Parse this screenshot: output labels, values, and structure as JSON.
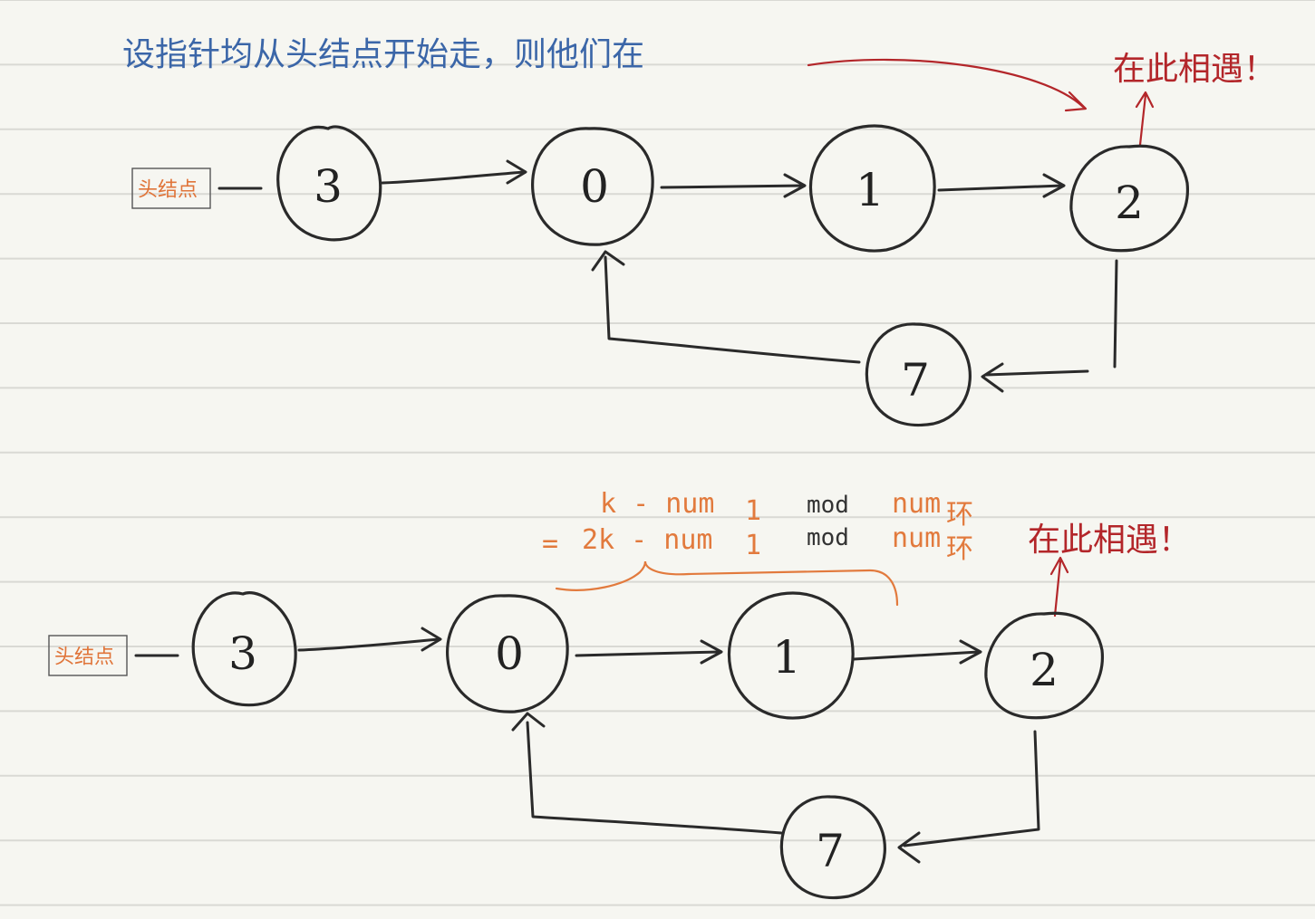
{
  "caption": "设指针均从头结点开始走，则他们在",
  "meet_label": "在此相遇！",
  "head_label": "头结点",
  "nodes": [
    "3",
    "0",
    "1",
    "2",
    "7"
  ],
  "formula": {
    "line1_left": "k - num",
    "line1_sub": "1",
    "line1_mod": "mod",
    "line1_right": "num",
    "line1_right_sub": "环",
    "line2_eq": "=",
    "line2_left": "2k - num",
    "line2_sub": "1",
    "line2_mod": "mod",
    "line2_right": "num",
    "line2_right_sub": "环"
  },
  "colors": {
    "paper": "#f6f6f1",
    "rule": "#d9d9d4",
    "ink": "#2a2a2a",
    "blue": "#3b66a8",
    "red": "#b3262a",
    "orange": "#e27a3d"
  }
}
